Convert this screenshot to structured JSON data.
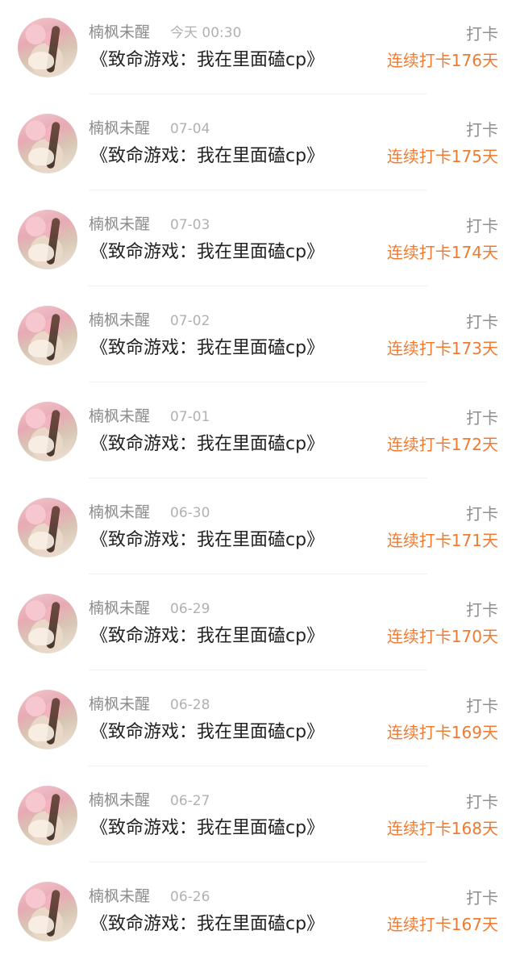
{
  "feed": {
    "items": [
      {
        "username": "楠枫未醒",
        "date": "今天 00:30",
        "title": "《致命游戏：我在里面磕cp》",
        "action": "打卡",
        "streak": "连续打卡176天"
      },
      {
        "username": "楠枫未醒",
        "date": "07-04",
        "title": "《致命游戏：我在里面磕cp》",
        "action": "打卡",
        "streak": "连续打卡175天"
      },
      {
        "username": "楠枫未醒",
        "date": "07-03",
        "title": "《致命游戏：我在里面磕cp》",
        "action": "打卡",
        "streak": "连续打卡174天"
      },
      {
        "username": "楠枫未醒",
        "date": "07-02",
        "title": "《致命游戏：我在里面磕cp》",
        "action": "打卡",
        "streak": "连续打卡173天"
      },
      {
        "username": "楠枫未醒",
        "date": "07-01",
        "title": "《致命游戏：我在里面磕cp》",
        "action": "打卡",
        "streak": "连续打卡172天"
      },
      {
        "username": "楠枫未醒",
        "date": "06-30",
        "title": "《致命游戏：我在里面磕cp》",
        "action": "打卡",
        "streak": "连续打卡171天"
      },
      {
        "username": "楠枫未醒",
        "date": "06-29",
        "title": "《致命游戏：我在里面磕cp》",
        "action": "打卡",
        "streak": "连续打卡170天"
      },
      {
        "username": "楠枫未醒",
        "date": "06-28",
        "title": "《致命游戏：我在里面磕cp》",
        "action": "打卡",
        "streak": "连续打卡169天"
      },
      {
        "username": "楠枫未醒",
        "date": "06-27",
        "title": "《致命游戏：我在里面磕cp》",
        "action": "打卡",
        "streak": "连续打卡168天"
      },
      {
        "username": "楠枫未醒",
        "date": "06-26",
        "title": "《致命游戏：我在里面磕cp》",
        "action": "打卡",
        "streak": "连续打卡167天"
      }
    ]
  }
}
